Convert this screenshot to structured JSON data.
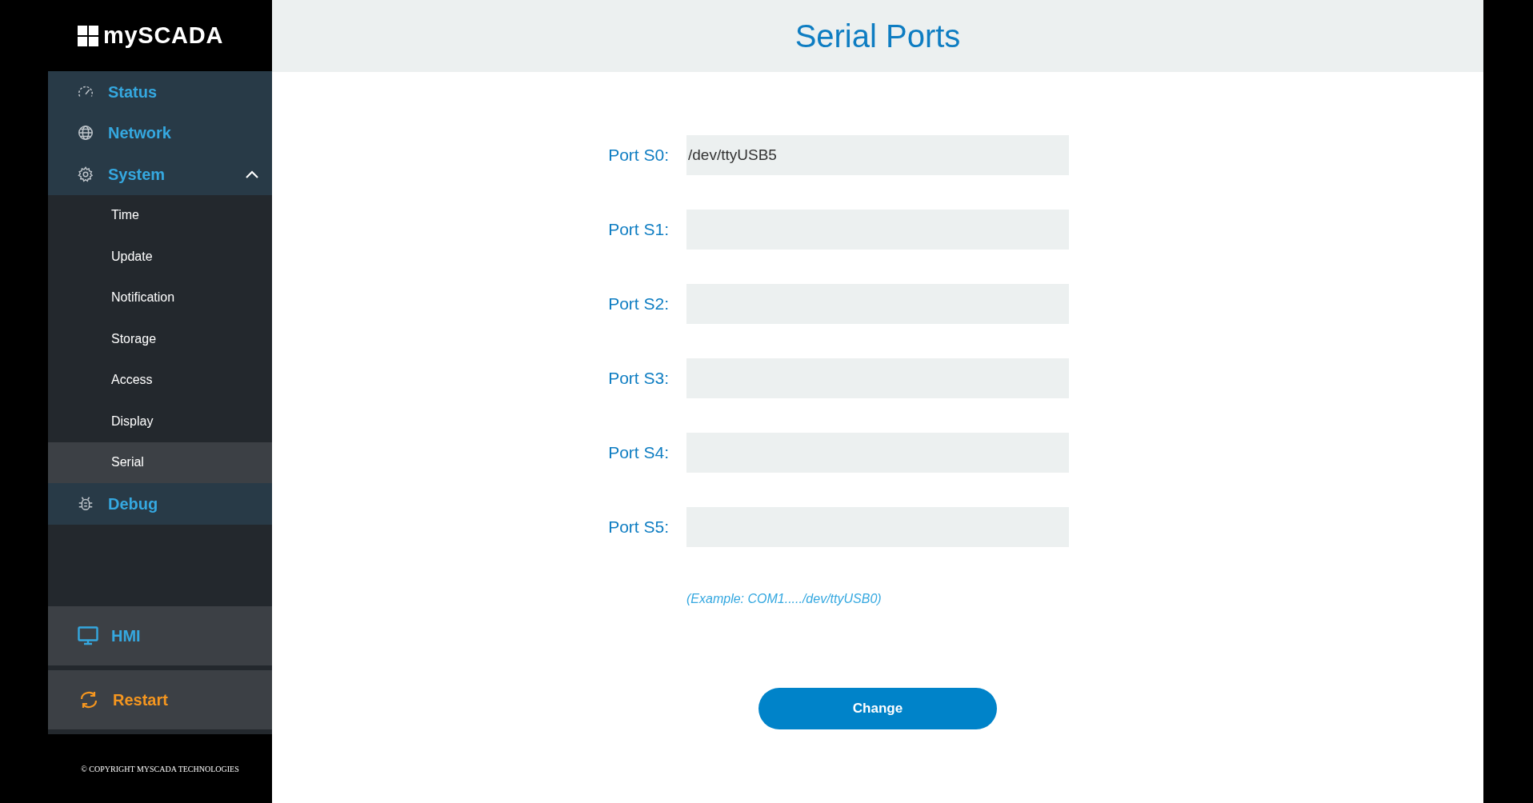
{
  "logo": {
    "text": "mySCADA"
  },
  "sidebar": {
    "items": [
      {
        "label": "Status",
        "selected": false
      },
      {
        "label": "Network",
        "selected": false
      },
      {
        "label": "System",
        "selected": false,
        "expanded": true,
        "children": [
          {
            "label": "Time",
            "selected": false
          },
          {
            "label": "Update",
            "selected": false
          },
          {
            "label": "Notification",
            "selected": false
          },
          {
            "label": "Storage",
            "selected": false
          },
          {
            "label": "Access",
            "selected": false
          },
          {
            "label": "Display",
            "selected": false
          },
          {
            "label": "Serial",
            "selected": true
          }
        ]
      },
      {
        "label": "Debug",
        "selected": false
      }
    ],
    "bottom_items": [
      {
        "label": "HMI",
        "kind": "hmi"
      },
      {
        "label": "Restart",
        "kind": "restart"
      }
    ],
    "copyright": "© COPYRIGHT MYSCADA TECHNOLOGIES"
  },
  "page": {
    "title": "Serial Ports",
    "ports": [
      {
        "label": "Port S0:",
        "value": "/dev/ttyUSB5"
      },
      {
        "label": "Port S1:"
      },
      {
        "label": "Port S2:"
      },
      {
        "label": "Port S3:"
      },
      {
        "label": "Port S4:"
      },
      {
        "label": "Port S5:"
      }
    ],
    "hint": "(Example: COM1...../dev/ttyUSB0)",
    "button": "Change"
  }
}
